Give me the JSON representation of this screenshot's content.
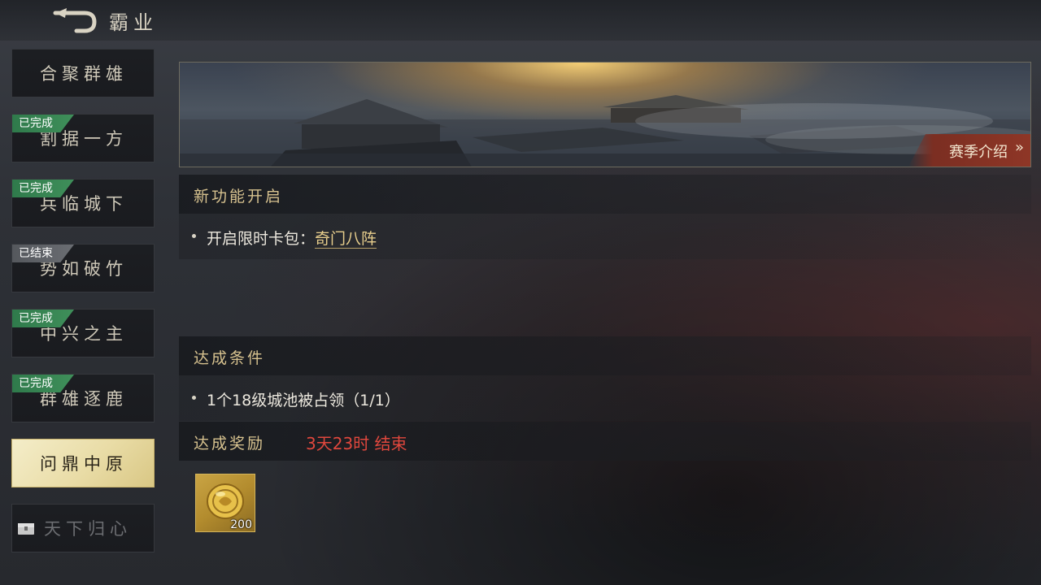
{
  "header": {
    "title": "霸业"
  },
  "sidebar": {
    "items": [
      {
        "label": "合聚群雄",
        "status": "已完成"
      },
      {
        "label": "割据一方",
        "status": "已完成"
      },
      {
        "label": "兵临城下",
        "status": "已完成"
      },
      {
        "label": "势如破竹",
        "status": "已结束"
      },
      {
        "label": "中兴之主",
        "status": "已完成"
      },
      {
        "label": "群雄逐鹿",
        "status": "已完成"
      },
      {
        "label": "问鼎中原",
        "status": ""
      },
      {
        "label": "天下归心",
        "status": ""
      }
    ]
  },
  "banner": {
    "season_label": "赛季介绍",
    "arrow": "»"
  },
  "new_feature": {
    "title": "新功能开启",
    "item_prefix": "开启限时卡包：",
    "item_link": "奇门八阵"
  },
  "condition": {
    "title": "达成条件",
    "item": "1个18级城池被占领（1/1）"
  },
  "reward": {
    "title": "达成奖励",
    "timer": "3天23时 结束",
    "items": [
      {
        "icon": "gold-coin-icon",
        "count": "200"
      }
    ]
  },
  "colors": {
    "accent_gold": "#d7c28f",
    "badge_done": "#3f8f5a",
    "badge_ended": "#6a6d72",
    "timer_red": "#e0473d"
  }
}
